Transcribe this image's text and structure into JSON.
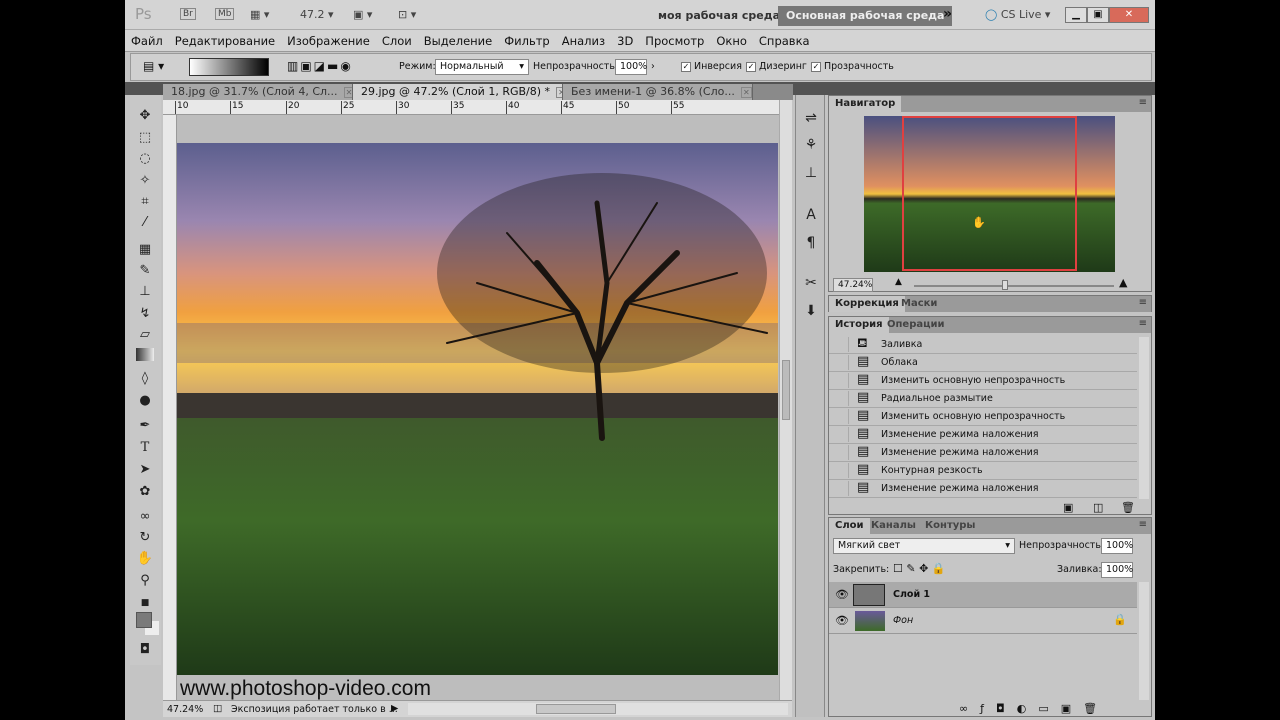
{
  "titlebar": {
    "logo": "Ps",
    "bridge": "Br",
    "mini_bridge": "Mb",
    "zoom": "47.2",
    "workspace_custom": "моя рабочая среда",
    "workspace_active": "Основная рабочая среда",
    "more": "»",
    "cs_live": "CS Live ▾"
  },
  "menu": [
    "Файл",
    "Редактирование",
    "Изображение",
    "Слои",
    "Выделение",
    "Фильтр",
    "Анализ",
    "3D",
    "Просмотр",
    "Окно",
    "Справка"
  ],
  "options": {
    "mode_label": "Режим:",
    "mode_value": "Нормальный",
    "opacity_label": "Непрозрачность:",
    "opacity_value": "100%",
    "inverse": "Инверсия",
    "dither": "Дизеринг",
    "transparency": "Прозрачность"
  },
  "tabs": [
    {
      "label": "18.jpg @ 31.7% (Слой 4, Сл..."
    },
    {
      "label": "29.jpg @ 47.2% (Слой 1, RGB/8) *"
    },
    {
      "label": "Без имени-1 @ 36.8% (Сло..."
    }
  ],
  "ruler_ticks": [
    "10",
    "15",
    "20",
    "25",
    "30",
    "35",
    "40",
    "45",
    "50",
    "55"
  ],
  "watermark": "www.photoshop-video.com",
  "status": {
    "zoom": "47.24%",
    "info": "Экспозиция работает только в ..."
  },
  "navigator": {
    "title": "Навигатор",
    "zoom": "47.24%"
  },
  "correction": {
    "tabs": [
      "Коррекция",
      "Маски"
    ]
  },
  "history": {
    "tabs": [
      "История",
      "Операции"
    ],
    "items": [
      "Заливка",
      "Облака",
      "Изменить основную непрозрачность",
      "Радиальное размытие",
      "Изменить основную непрозрачность",
      "Изменение режима наложения",
      "Изменение режима наложения",
      "Контурная резкость",
      "Изменение режима наложения"
    ]
  },
  "layers": {
    "tabs": [
      "Слои",
      "Каналы",
      "Контуры"
    ],
    "blend_mode": "Мягкий свет",
    "opacity_label": "Непрозрачность:",
    "opacity_value": "100%",
    "lock_label": "Закрепить:",
    "fill_label": "Заливка:",
    "fill_value": "100%",
    "items": [
      {
        "name": "Слой 1",
        "selected": true
      },
      {
        "name": "Фон",
        "locked": true
      }
    ]
  },
  "colors": {
    "panel": "#c6c6c6",
    "dark_strip": "#535353",
    "nav_frame": "#e04040"
  }
}
